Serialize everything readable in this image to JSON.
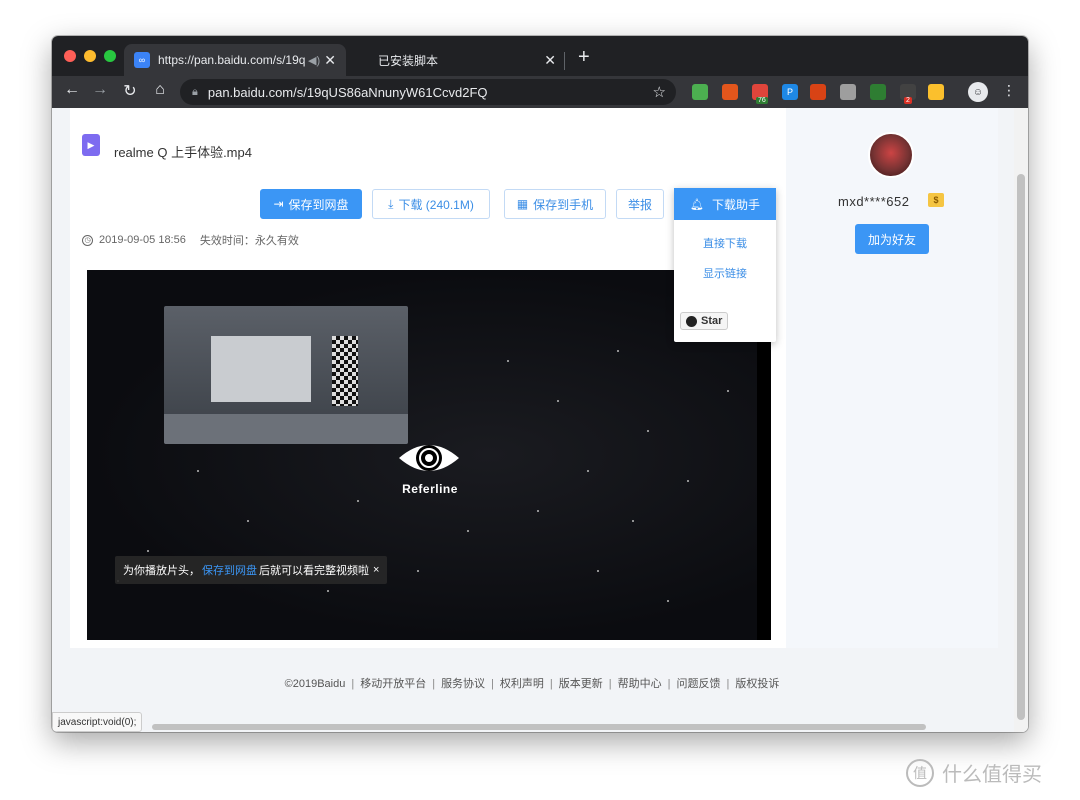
{
  "browser": {
    "active_tab": {
      "title": "https://pan.baidu.com/s/19q",
      "favicon": "baidu-cloud-icon"
    },
    "inactive_tab": {
      "title": "已安装脚本"
    },
    "url": "pan.baidu.com/s/19qUS86aNnunyW61Ccvd2FQ",
    "extensions": [
      {
        "name": "evernote-ext",
        "color": "#4caf50"
      },
      {
        "name": "cookie-ext",
        "color": "#e2561c"
      },
      {
        "name": "pocket-ext",
        "color": "#e0453b",
        "badge": "76"
      },
      {
        "name": "p-ext",
        "color": "#1e88e5",
        "label": "P"
      },
      {
        "name": "pinwheel-ext",
        "color": "#d84315"
      },
      {
        "name": "speed-ext",
        "color": "#9e9e9e"
      },
      {
        "name": "green-ext",
        "color": "#2e7d32"
      },
      {
        "name": "screen-ext",
        "color": "#424242",
        "badge": "2"
      },
      {
        "name": "multicolor-ext",
        "color": "#fbc02d"
      }
    ]
  },
  "file": {
    "name": "realme Q 上手体验.mp4",
    "date": "2019-09-05 18:56",
    "expire": "失效时间：永久有效"
  },
  "actions": {
    "save": "保存到网盘",
    "download": "下载 (240.1M)",
    "save_phone": "保存到手机",
    "report": "举报",
    "helper": "下载助手"
  },
  "helper_menu": {
    "direct": "直接下载",
    "show_link": "显示链接",
    "star": "Star"
  },
  "video": {
    "brand": "Referline",
    "tip_prefix": "为你播放片头，",
    "tip_link": "保存到网盘",
    "tip_suffix": "后就可以看完整视频啦",
    "tip_close": "×"
  },
  "user": {
    "name": "mxd****652",
    "vip_badge": "$",
    "add_friend": "加为好友"
  },
  "footer": {
    "links": [
      "©2019Baidu",
      "移动开放平台",
      "服务协议",
      "权利声明",
      "版本更新",
      "帮助中心",
      "问题反馈",
      "版权投诉"
    ]
  },
  "status_bar": "javascript:void(0);",
  "watermark": "什么值得买",
  "colors": {
    "accent": "#3b96f5",
    "tab_bg": "#202124",
    "toolbar_bg": "#35363a"
  }
}
